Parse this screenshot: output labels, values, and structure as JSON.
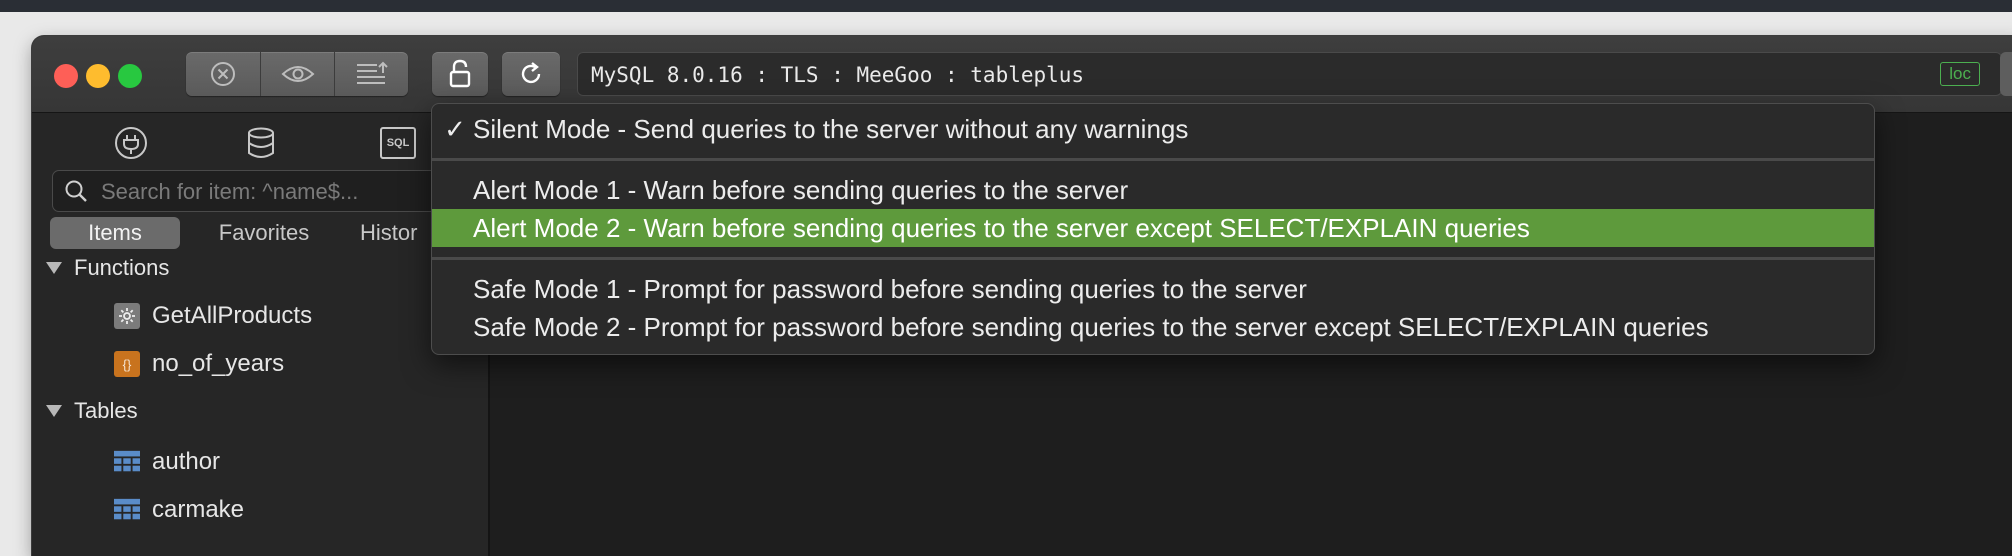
{
  "window": {
    "connection_label": "MySQL 8.0.16 : TLS : MeeGoo : tableplus",
    "location_badge": "loc"
  },
  "toolbar": {
    "icons": [
      "close-circle-icon",
      "eye-icon",
      "list-upload-icon",
      "lock-icon",
      "refresh-icon"
    ]
  },
  "sidebar": {
    "sql_icon_text": "SQL",
    "search_placeholder": "Search for item: ^name$...",
    "tabs": [
      {
        "label": "Items",
        "active": true
      },
      {
        "label": "Favorites",
        "active": false
      },
      {
        "label": "Histor",
        "active": false
      }
    ],
    "groups": [
      {
        "label": "Functions",
        "items": [
          {
            "label": "GetAllProducts",
            "icon": "gear-icon"
          },
          {
            "label": "no_of_years",
            "icon": "braces-icon",
            "icon_text": "{}"
          }
        ]
      },
      {
        "label": "Tables",
        "items": [
          {
            "label": "author",
            "icon": "table-icon"
          },
          {
            "label": "carmake",
            "icon": "table-icon"
          }
        ]
      }
    ]
  },
  "safe_mode_menu": {
    "check_mark": "✓",
    "items": [
      {
        "label": "Silent Mode - Send queries to the server without any warnings",
        "checked": true
      },
      {
        "label": "Alert Mode 1 - Warn before sending queries to the server",
        "checked": false
      },
      {
        "label": "Alert Mode 2 - Warn before sending queries to the server except SELECT/EXPLAIN queries",
        "checked": false,
        "highlighted": true
      },
      {
        "label": "Safe Mode 1 - Prompt for password before sending queries to the server",
        "checked": false
      },
      {
        "label": "Safe Mode 2 - Prompt for password before sending queries to the server except SELECT/EXPLAIN queries",
        "checked": false
      }
    ],
    "highlight_color": "#5e9a3c"
  },
  "colors": {
    "traffic_close": "#fe5f57",
    "traffic_minimize": "#febc2e",
    "traffic_zoom": "#28c840",
    "accent_green": "#4caf50",
    "function_icon_orange": "#c8731e",
    "table_icon_blue": "#5a8cc8"
  }
}
